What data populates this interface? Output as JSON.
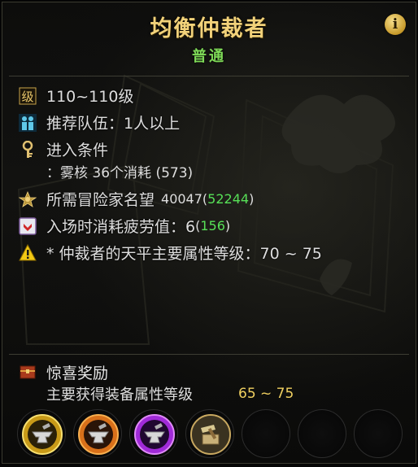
{
  "header": {
    "title": "均衡仲裁者",
    "difficulty": "普通",
    "info_icon_glyph": "i"
  },
  "colors": {
    "title": "#f2d27a",
    "difficulty": "#7ed957",
    "highlight_green": "#57e057",
    "range_gold": "#f0d060"
  },
  "info": {
    "level": {
      "icon": "level-icon",
      "text": "110~110级"
    },
    "party": {
      "icon": "party-icon",
      "text": "推荐队伍：1人以上"
    },
    "entry": {
      "icon": "key-icon",
      "label": "进入条件",
      "requirement": "：雾核 36个消耗 (573)"
    },
    "reputation": {
      "icon": "reputation-icon",
      "label": "所需冒险家名望",
      "required": "40047",
      "current": "52244"
    },
    "fatigue": {
      "icon": "fatigue-icon",
      "label": "入场时消耗疲劳值：6",
      "current": "156"
    },
    "warning": {
      "icon": "warning-icon",
      "text": "* 仲裁者的天平主要属性等级：70 ~ 75"
    }
  },
  "rewards": {
    "icon": "chest-icon",
    "title": "惊喜奖励",
    "label": "主要获得装备属性等级",
    "range": "65 ~ 75",
    "slots": [
      {
        "icon": "gold-anvil-icon",
        "variant": "gold"
      },
      {
        "icon": "orange-anvil-icon",
        "variant": "orange"
      },
      {
        "icon": "purple-anvil-icon",
        "variant": "purple"
      },
      {
        "icon": "hammer-box-icon",
        "variant": "hammer"
      },
      {
        "icon": "empty-slot",
        "variant": "empty"
      },
      {
        "icon": "empty-slot",
        "variant": "empty"
      },
      {
        "icon": "empty-slot",
        "variant": "empty"
      }
    ]
  }
}
